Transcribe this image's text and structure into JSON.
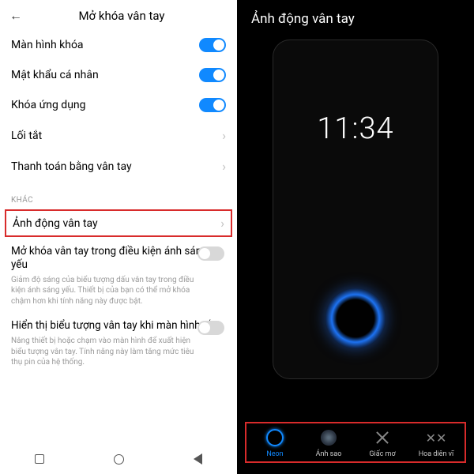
{
  "left": {
    "header_title": "Mở khóa vân tay",
    "rows": {
      "lock_screen": "Màn hình khóa",
      "personal_pwd": "Mật khẩu cá nhân",
      "app_lock": "Khóa ứng dụng",
      "shortcut": "Lối tắt",
      "fingerprint_payment": "Thanh toán bằng vân tay"
    },
    "section_label": "KHÁC",
    "animation_row": "Ảnh động vân tay",
    "lowlight": {
      "title": "Mở khóa vân tay trong điều kiện ánh sáng yếu",
      "desc": "Giảm độ sáng của biểu tượng dấu vân tay trong điều kiện ánh sáng yếu. Thiết bị của bạn có thể mở khóa chậm hơn khi tính năng này được bật."
    },
    "show_icon": {
      "title": "Hiển thị biểu tượng vân tay khi màn hình tắt",
      "desc": "Nâng thiết bị hoặc chạm vào màn hình để xuất hiện biểu tượng vân tay. Tính năng này làm tăng mức tiêu thụ pin của hệ thống."
    }
  },
  "right": {
    "title": "Ảnh động vân tay",
    "clock": "11:34",
    "options": {
      "neon": "Neon",
      "star": "Ánh sao",
      "dream": "Giấc mơ",
      "butterfly": "Hoa diên vĩ"
    }
  }
}
